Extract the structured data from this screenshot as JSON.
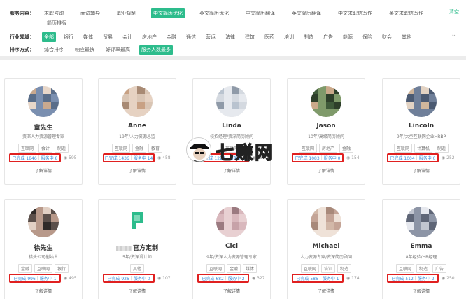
{
  "filters": {
    "row1_label": "服务内容：",
    "row1": [
      {
        "label": "求职咨询",
        "active": false
      },
      {
        "label": "面试辅导",
        "active": false
      },
      {
        "label": "职业规划",
        "active": false
      },
      {
        "label": "中文简历优化",
        "active": true
      },
      {
        "label": "英文简历优化",
        "active": false
      },
      {
        "label": "中文简历翻译",
        "active": false
      },
      {
        "label": "英文简历翻译",
        "active": false
      },
      {
        "label": "中文求职信写作",
        "active": false
      },
      {
        "label": "英文求职信写作",
        "active": false
      }
    ],
    "row1b": [
      {
        "label": "简历排版",
        "active": false
      }
    ],
    "clear": "清空",
    "row2_label": "行业领域：",
    "row2": [
      {
        "label": "全部",
        "active": true
      },
      {
        "label": "银行",
        "active": false
      },
      {
        "label": "媒体",
        "active": false
      },
      {
        "label": "贸易",
        "active": false
      },
      {
        "label": "会计",
        "active": false
      },
      {
        "label": "房地产",
        "active": false
      },
      {
        "label": "金融",
        "active": false
      },
      {
        "label": "通信",
        "active": false
      },
      {
        "label": "营运",
        "active": false
      },
      {
        "label": "法律",
        "active": false
      },
      {
        "label": "建筑",
        "active": false
      },
      {
        "label": "医药",
        "active": false
      },
      {
        "label": "培训",
        "active": false
      },
      {
        "label": "制造",
        "active": false
      },
      {
        "label": "广告",
        "active": false
      },
      {
        "label": "能源",
        "active": false
      },
      {
        "label": "保险",
        "active": false
      },
      {
        "label": "财会",
        "active": false
      },
      {
        "label": "其他",
        "active": false
      }
    ],
    "row3_label": "排序方式：",
    "row3": [
      {
        "label": "综合排序",
        "active": false
      },
      {
        "label": "响应最快",
        "active": false
      },
      {
        "label": "好评率最高",
        "active": false
      },
      {
        "label": "服务人数最多",
        "active": true
      }
    ],
    "more_icon": "chevron-down-icon"
  },
  "cards": [
    {
      "name": "童先生",
      "title": "资深人力资源管理专家",
      "tags": [
        "互联网",
        "会计",
        "制造"
      ],
      "completed": "已完成 1846",
      "serving": "服务中 8",
      "views": "595",
      "detail": "了解详情",
      "avatar_colors": [
        "#c9a98f",
        "#7a8fb0",
        "#e8d7c9",
        "#5a6e8a"
      ]
    },
    {
      "name": "Anne",
      "title": "19年/人力资源总监",
      "tags": [
        "互联网",
        "金融",
        "教育"
      ],
      "completed": "已完成 1436",
      "serving": "服务中 14",
      "views": "458",
      "detail": "了解详情",
      "avatar_colors": [
        "#c8a184",
        "#e6d2c2",
        "#a88a74",
        "#d9c5b4"
      ]
    },
    {
      "name": "Linda",
      "title": "校招经理/资深简历顾问",
      "tags": [
        "互联网"
      ],
      "completed": "已完成 1224",
      "serving": "服务中 2",
      "views": "486",
      "detail": "了解详情",
      "avatar_colors": [
        "#b9c3cf",
        "#e6e9ee",
        "#8f9aa8",
        "#d4d9e0"
      ]
    },
    {
      "name": "Jason",
      "title": "10年/高级简历顾问",
      "tags": [
        "互联网",
        "房地产",
        "金融"
      ],
      "completed": "已完成 1083",
      "serving": "服务中 0",
      "views": "154",
      "detail": "了解详情",
      "avatar_colors": [
        "#3f5a3a",
        "#7f9a6a",
        "#caa98a",
        "#2e3f2a"
      ]
    },
    {
      "name": "Lincoln",
      "title": "9年/大型互联网企业HRBP",
      "tags": [
        "互联网",
        "计算机",
        "制造"
      ],
      "completed": "已完成 1004",
      "serving": "服务中 0",
      "views": "252",
      "detail": "了解详情",
      "avatar_colors": [
        "#d0b69c",
        "#6f7f99",
        "#e3d3c3",
        "#4b5a72"
      ]
    },
    {
      "name": "徐先生",
      "title": "猎头公司创始人",
      "tags": [
        "金融",
        "互联网",
        "银行"
      ],
      "completed": "已完成 996",
      "serving": "服务中 1",
      "views": "495",
      "detail": "了解详情",
      "avatar_colors": [
        "#2f2a28",
        "#b8998a",
        "#e2d0c4",
        "#5b4f4a"
      ]
    },
    {
      "name": "官方定制",
      "title": "5年/资深设计师",
      "tags": [
        "其他"
      ],
      "completed": "已完成 926",
      "serving": "服务中 0",
      "views": "107",
      "detail": "了解详情",
      "avatar_colors": [
        "#ffffff",
        "#ffffff",
        "#ffffff",
        "#ffffff"
      ],
      "green_logo": true
    },
    {
      "name": "Cici",
      "title": "9年/资深人力资源管理专家",
      "tags": [
        "互联网",
        "金融",
        "媒体"
      ],
      "completed": "已完成 682",
      "serving": "服务中 2",
      "views": "327",
      "detail": "了解详情",
      "avatar_colors": [
        "#c7a2a8",
        "#e8d0d2",
        "#9b7a80",
        "#d9b8bd"
      ]
    },
    {
      "name": "Michael",
      "title": "人力资源专家/资深简历顾问",
      "tags": [
        "互联网",
        "培训",
        "制造"
      ],
      "completed": "已完成 586",
      "serving": "服务中 1",
      "views": "174",
      "detail": "了解详情",
      "avatar_colors": [
        "#d2b8a8",
        "#efe2d8",
        "#a8897a",
        "#c4a496"
      ]
    },
    {
      "name": "Emma",
      "title": "8年经验/HR经理",
      "tags": [
        "互联网",
        "制造",
        "广告"
      ],
      "completed": "已完成 512",
      "serving": "服务中 2",
      "views": "250",
      "detail": "了解详情",
      "avatar_colors": [
        "#c2c6d0",
        "#8d95a6",
        "#e6e8ee",
        "#5f6677"
      ]
    }
  ],
  "watermark": {
    "text": "七赚网"
  },
  "colors": {
    "accent": "#2dbc8c",
    "highlight": "#e02020",
    "link": "#3b8ad6"
  }
}
